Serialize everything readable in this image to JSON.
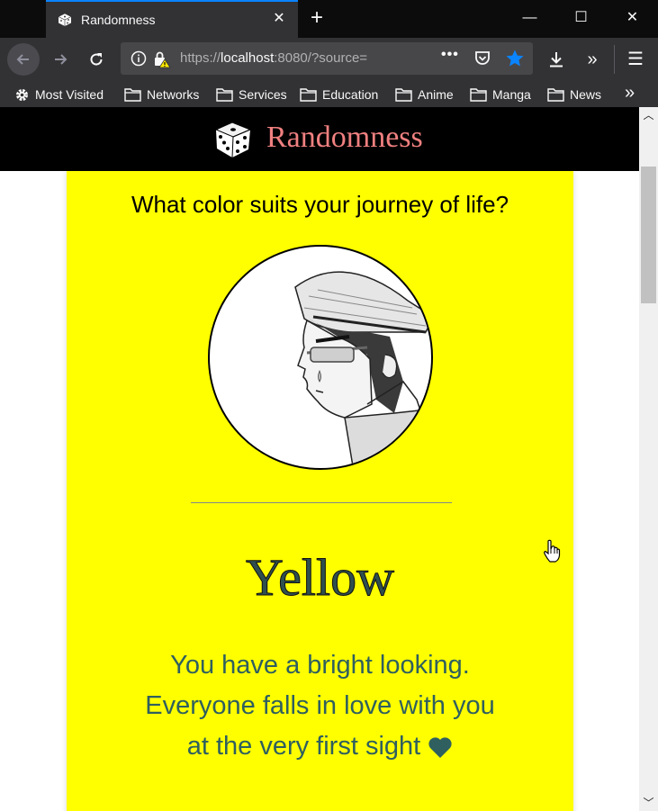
{
  "browser": {
    "tab_title": "Randomness",
    "url_prefix": "https://",
    "url_host": "localhost",
    "url_rest": ":8080/?source=",
    "new_tab_symbol": "+",
    "tab_close_symbol": "✕",
    "window_minimize": "—",
    "window_maximize": "☐",
    "window_close": "✕",
    "overflow_symbol": "»",
    "menu_symbol": "☰",
    "icons": [
      "dice-icon",
      "info-icon",
      "lock-warning-icon",
      "pocket-icon",
      "star-icon",
      "download-icon",
      "folder-icon",
      "gear-icon"
    ],
    "colors": {
      "accent": "#0a84ff",
      "chrome": "#323234",
      "titlebar": "#0c0c0d"
    }
  },
  "bookmarks": [
    {
      "label": "Most Visited",
      "icon": "gear-icon"
    },
    {
      "label": "Networks",
      "icon": "folder-icon"
    },
    {
      "label": "Services",
      "icon": "folder-icon"
    },
    {
      "label": "Education",
      "icon": "folder-icon"
    },
    {
      "label": "Anime",
      "icon": "folder-icon"
    },
    {
      "label": "Manga",
      "icon": "folder-icon"
    },
    {
      "label": "News",
      "icon": "folder-icon"
    }
  ],
  "site": {
    "title": "Randomness",
    "title_color": "#f08080"
  },
  "result": {
    "question": "What color suits your journey of life?",
    "color_name": "Yellow",
    "card_color": "#ffff00",
    "description_lines": [
      "You have a bright looking.",
      "Everyone falls in love with you",
      "at the very first sight"
    ],
    "heart_icon": "heart-icon"
  }
}
